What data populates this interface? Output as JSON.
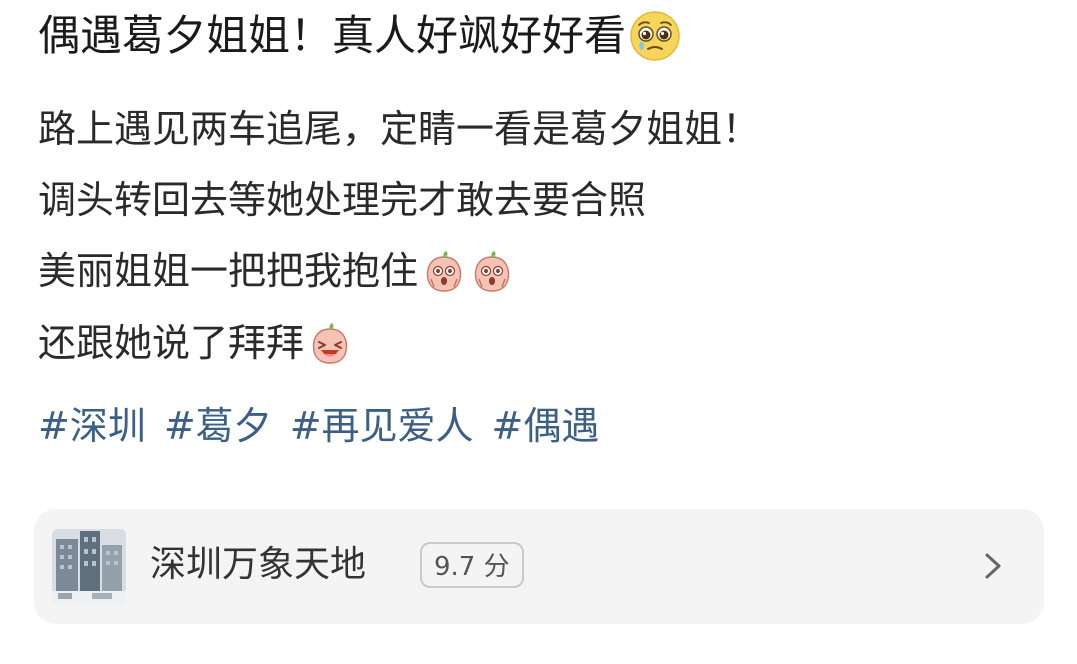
{
  "post": {
    "title": "偶遇葛夕姐姐！真人好飒好好看",
    "title_emoji": "pleading-face-emoji",
    "lines": [
      "路上遇见两车追尾，定睛一看是葛夕姐姐！",
      "调头转回去等她处理完才敢去要合照",
      "美丽姐姐一把把我抱住",
      "还跟她说了拜拜"
    ],
    "line3_emojis": [
      "peach-shocked-emoji",
      "peach-shocked-emoji"
    ],
    "line4_emoji": "peach-laughing-emoji"
  },
  "hashtags": [
    "#深圳",
    "#葛夕",
    "#再见爱人",
    "#偶遇"
  ],
  "location": {
    "name": "深圳万象天地",
    "rating": "9.7 分",
    "thumbnail": "building-photo",
    "chevron_icon": "chevron-right-icon"
  },
  "colors": {
    "hashtag": "#3b5f86",
    "card_bg": "#f4f4f4",
    "text": "#2a2a2a"
  }
}
